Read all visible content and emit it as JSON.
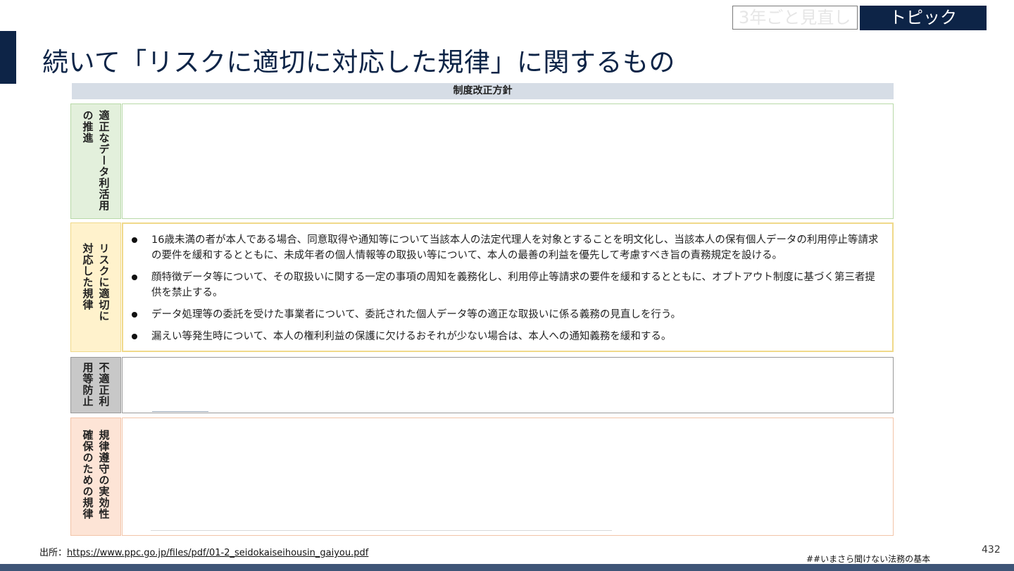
{
  "tags": {
    "outline": "3年ごと見直し",
    "filled": "トピック"
  },
  "title": "続いて「リスクに適切に対応した規律」に関するもの",
  "table": {
    "header": "制度改正方針",
    "rows": [
      {
        "label_cols": [
          "適正なデータ利活用",
          "の推進"
        ],
        "bg": "#e3f0dc",
        "border": "#b8d9a8"
      },
      {
        "label_cols": [
          "リスクに適切に",
          "対応した規律"
        ],
        "bg": "#fff2cc",
        "border": "#f0d98a",
        "bullets": [
          "16歳未満の者が本人である場合、同意取得や通知等について当該本人の法定代理人を対象とすることを明文化し、当該本人の保有個人データの利用停止等請求の要件を緩和するとともに、未成年者の個人情報等の取扱い等について、本人の最善の利益を優先して考慮すべき旨の責務規定を設ける。",
          "顔特徴データ等について、その取扱いに関する一定の事項の周知を義務化し、利用停止等請求の要件を緩和するとともに、オプトアウト制度に基づく第三者提供を禁止する。",
          "データ処理等の委託を受けた事業者について、委託された個人データ等の適正な取扱いに係る義務の見直しを行う。",
          "漏えい等発生時について、本人の権利利益の保護に欠けるおそれが少ない場合は、本人への通知義務を緩和する。"
        ]
      },
      {
        "label_cols": [
          "不適正利",
          "用等防止"
        ],
        "bg": "#c8c8c8",
        "border": "#9a9a9a"
      },
      {
        "label_cols": [
          "規律遵守の実効性",
          "確保のための規律"
        ],
        "bg": "#fde4d6",
        "border": "#f2c4a8"
      }
    ]
  },
  "footer": {
    "source_label": "出所：",
    "source_url": "https://www.ppc.go.jp/files/pdf/01-2_seidokaiseihousin_gaiyou.pdf",
    "hashtag": "##いまさら聞けない法務の基本",
    "page_number": "432"
  }
}
